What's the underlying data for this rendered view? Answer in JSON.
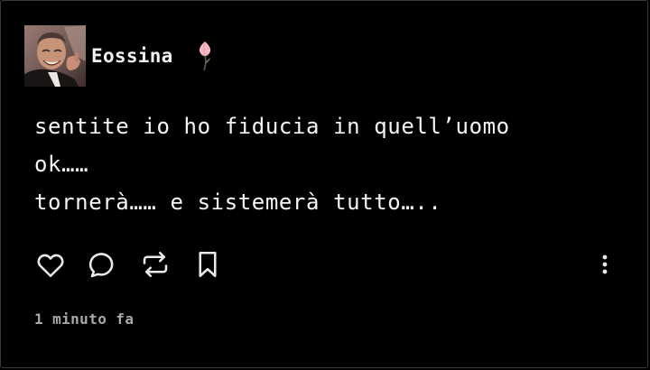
{
  "post": {
    "username": "Eossina",
    "text": "sentite io ho fiducia in quell’uomo\nok……\ntornerà…… e sistemerà tutto…..",
    "timestamp": "1 minuto fa"
  },
  "icons": {
    "avatar": "profile-photo",
    "badge": "pink-tulip-icon",
    "like": "heart-icon",
    "comment": "speech-bubble-icon",
    "repost": "repost-arrows-icon",
    "save": "bookmark-icon",
    "more": "vertical-ellipsis-icon"
  },
  "colors": {
    "background": "#000000",
    "text": "#f5f5f5",
    "muted": "#a9a9a9",
    "border": "#3a3a3a",
    "icon": "#eaeaea",
    "flower": "#f4b8c4"
  }
}
